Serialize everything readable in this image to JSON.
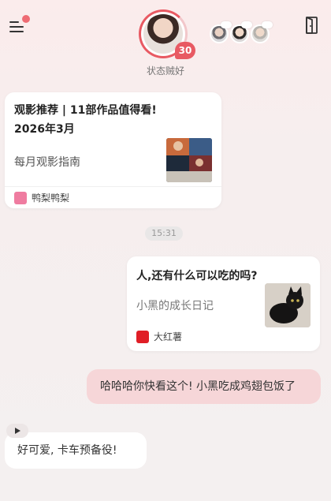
{
  "header": {
    "status_text": "状态贼好",
    "badge_count": "30",
    "menu_icon": "menu-icon",
    "exit_icon": "exit-door-icon",
    "accent_color": "#e85a63"
  },
  "feed": [
    {
      "type": "card",
      "title_line1": "观影推荐 | 11部作品值得看!",
      "title_line2": "2026年3月",
      "subtitle": "每月观影指南",
      "source": "鸭梨鸭梨",
      "source_color": "#ef7ca0"
    },
    {
      "type": "time",
      "text": "15:31"
    },
    {
      "type": "card",
      "title": "人,还有什么可以吃的吗?",
      "subtitle": "小黑的成长日记",
      "source": "大红薯",
      "source_color": "#e01e26"
    },
    {
      "type": "bubble-right",
      "text": "哈哈哈你快看这个! 小黑吃成鸡翅包饭了"
    },
    {
      "type": "bubble-left",
      "text": "好可爱, 卡车预备役!"
    }
  ]
}
